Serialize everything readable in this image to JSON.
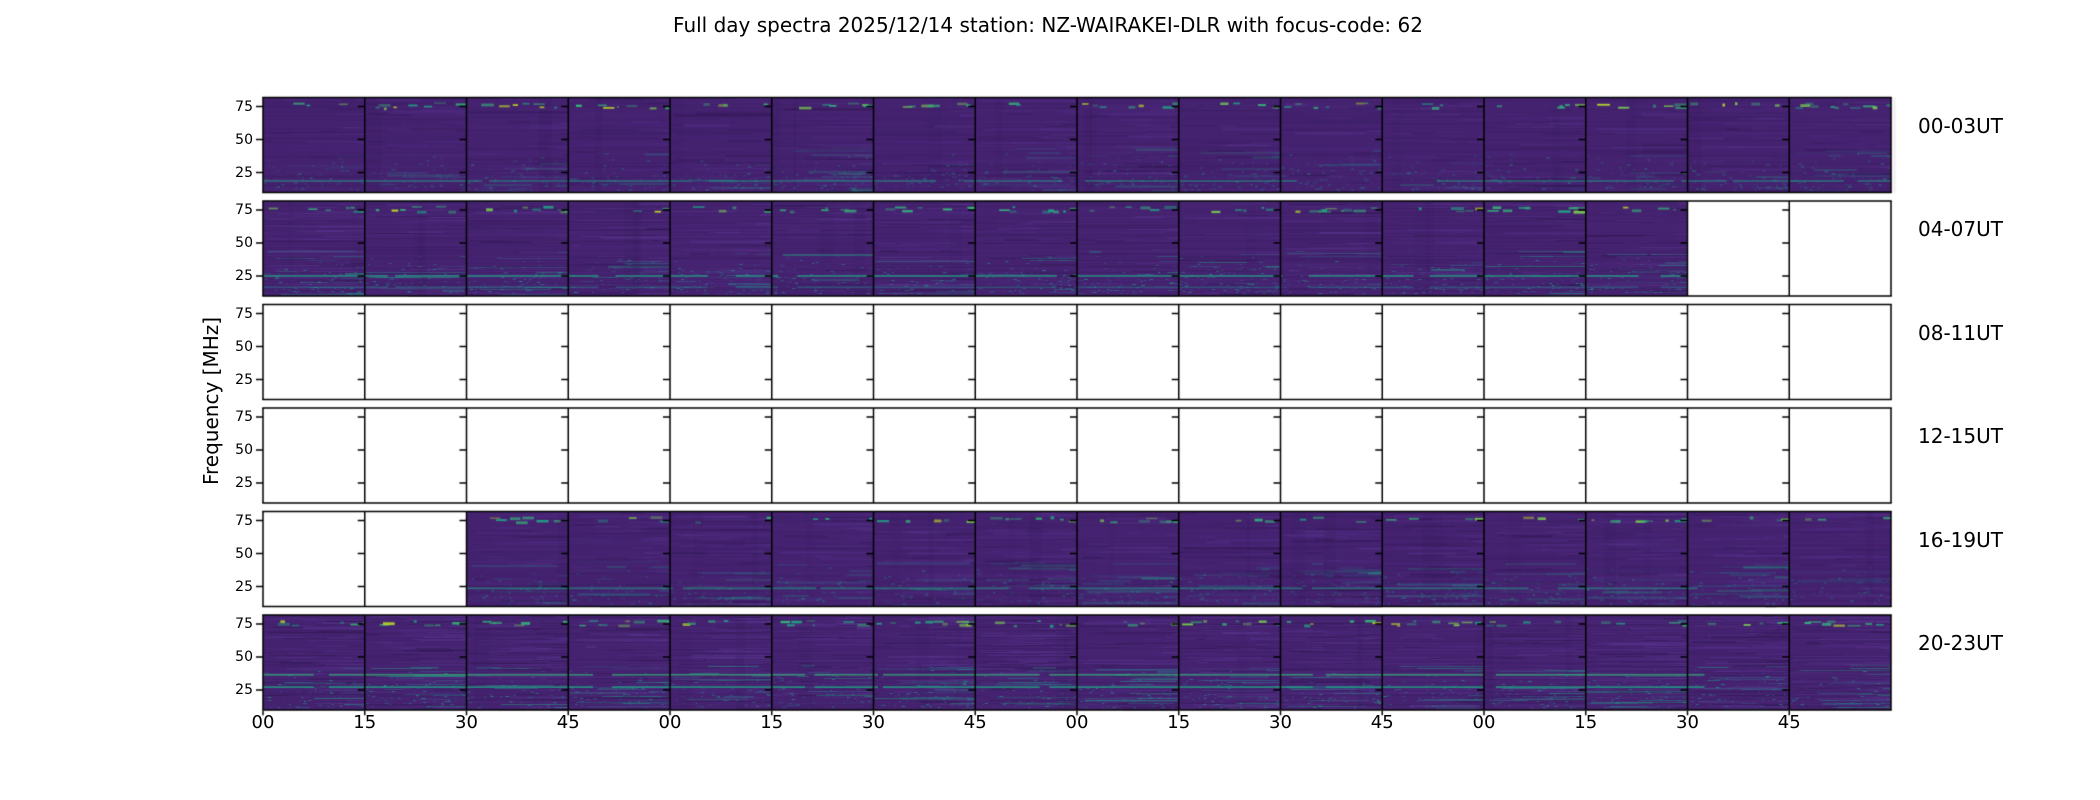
{
  "chart_data": {
    "type": "heatmap",
    "title": "Full day spectra 2025/12/14 station: NZ-WAIRAKEI-DLR with focus-code: 62",
    "meta": {
      "date": "2025/12/14",
      "station": "NZ-WAIRAKEI-DLR",
      "focus_code": "62"
    },
    "ylabel": "Frequency [MHz]",
    "y_ticks_top_to_bottom": [
      "75",
      "50",
      "25"
    ],
    "y_range_mhz": [
      10,
      82
    ],
    "colormap": "viridis",
    "segments_per_row": 16,
    "minutes_per_segment": 15,
    "hours_per_row": 4,
    "x_tick_labels": [
      "00",
      "15",
      "30",
      "45",
      "00",
      "15",
      "30",
      "45",
      "00",
      "15",
      "30",
      "45",
      "00",
      "15",
      "30",
      "45"
    ],
    "legend": "none",
    "grid": "segment boundaries only",
    "rows": [
      {
        "label": "00-03UT",
        "data_segments": {
          "start": 0,
          "end": 16
        },
        "render": {
          "top": 0.85,
          "body": 0.32,
          "bottom": 0.75,
          "lines": [
            [
              0.87,
              "teal2",
              0.5
            ]
          ]
        }
      },
      {
        "label": "04-07UT",
        "data_segments": {
          "start": 0,
          "end": 14
        },
        "render": {
          "top": 0.9,
          "body": 0.4,
          "bottom": 0.95,
          "lines": [
            [
              0.78,
              "teal2",
              0.75
            ],
            [
              0.9,
              "teal",
              0.45
            ]
          ]
        }
      },
      {
        "label": "08-11UT",
        "data_segments": null,
        "render": null
      },
      {
        "label": "12-15UT",
        "data_segments": null,
        "render": null
      },
      {
        "label": "16-19UT",
        "data_segments": {
          "start": 2,
          "end": 16
        },
        "render": {
          "top": 0.65,
          "body": 0.55,
          "bottom": 0.7,
          "lines": [
            [
              0.8,
              "teal2",
              0.55
            ]
          ]
        }
      },
      {
        "label": "20-23UT",
        "data_segments": {
          "start": 0,
          "end": 16
        },
        "render": {
          "top": 0.95,
          "body": 0.7,
          "bottom": 0.85,
          "lines": [
            [
              0.62,
              "green",
              0.7
            ],
            [
              0.75,
              "teal2",
              0.8
            ]
          ]
        }
      }
    ]
  },
  "palette": {
    "base": "#44226f",
    "purple_light": "#5b3690",
    "purple_light2": "#4e2b80",
    "purple_dark": "#2e164e",
    "teal": "#27838e",
    "teal2": "#21a585",
    "green": "#35b779",
    "bright": "#7ad151",
    "yellow": "#bddf26",
    "frame": "#000000",
    "background": "#ffffff"
  }
}
